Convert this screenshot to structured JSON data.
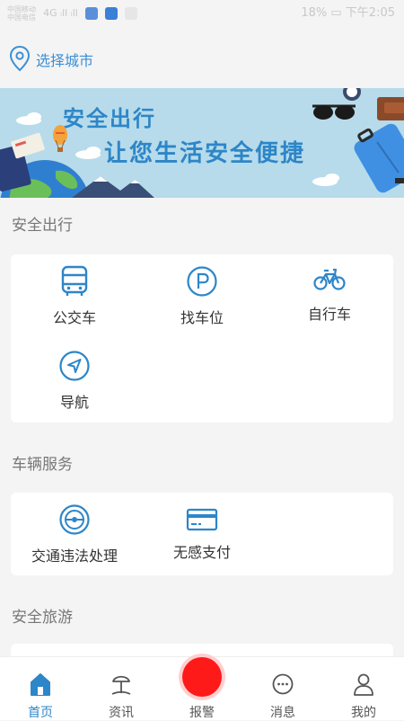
{
  "status_bar": {
    "carrier_line1": "中国移动",
    "carrier_line2": "中国电信",
    "signal": "4G ᵢll ᵢll",
    "right_text": "18% ▭ 下午2:05"
  },
  "location": {
    "city_label": "选择城市"
  },
  "banner": {
    "title_line1": "安全出行",
    "title_line2": "让您生活安全便捷"
  },
  "sections": {
    "safe_travel": {
      "title": "安全出行",
      "items": [
        {
          "label": "公交车",
          "icon": "bus-icon"
        },
        {
          "label": "找车位",
          "icon": "parking-icon"
        },
        {
          "label": "自行车",
          "icon": "bicycle-icon"
        },
        {
          "label": "导航",
          "icon": "navigation-icon"
        }
      ]
    },
    "vehicle_service": {
      "title": "车辆服务",
      "items": [
        {
          "label": "交通违法处理",
          "icon": "steering-wheel-icon"
        },
        {
          "label": "无感支付",
          "icon": "card-icon"
        }
      ]
    },
    "safe_tour": {
      "title": "安全旅游"
    }
  },
  "tabbar": {
    "items": [
      {
        "label": "首页",
        "icon": "home-icon",
        "active": true
      },
      {
        "label": "资讯",
        "icon": "beach-umbrella-icon",
        "active": false
      },
      {
        "label": "报警",
        "icon": "alarm-icon",
        "active": false
      },
      {
        "label": "消息",
        "icon": "message-icon",
        "active": false
      },
      {
        "label": "我的",
        "icon": "user-icon",
        "active": false
      }
    ]
  },
  "colors": {
    "accent": "#2d86c8",
    "alarm": "#ff1a1a",
    "banner_bg": "#b7dbea"
  }
}
